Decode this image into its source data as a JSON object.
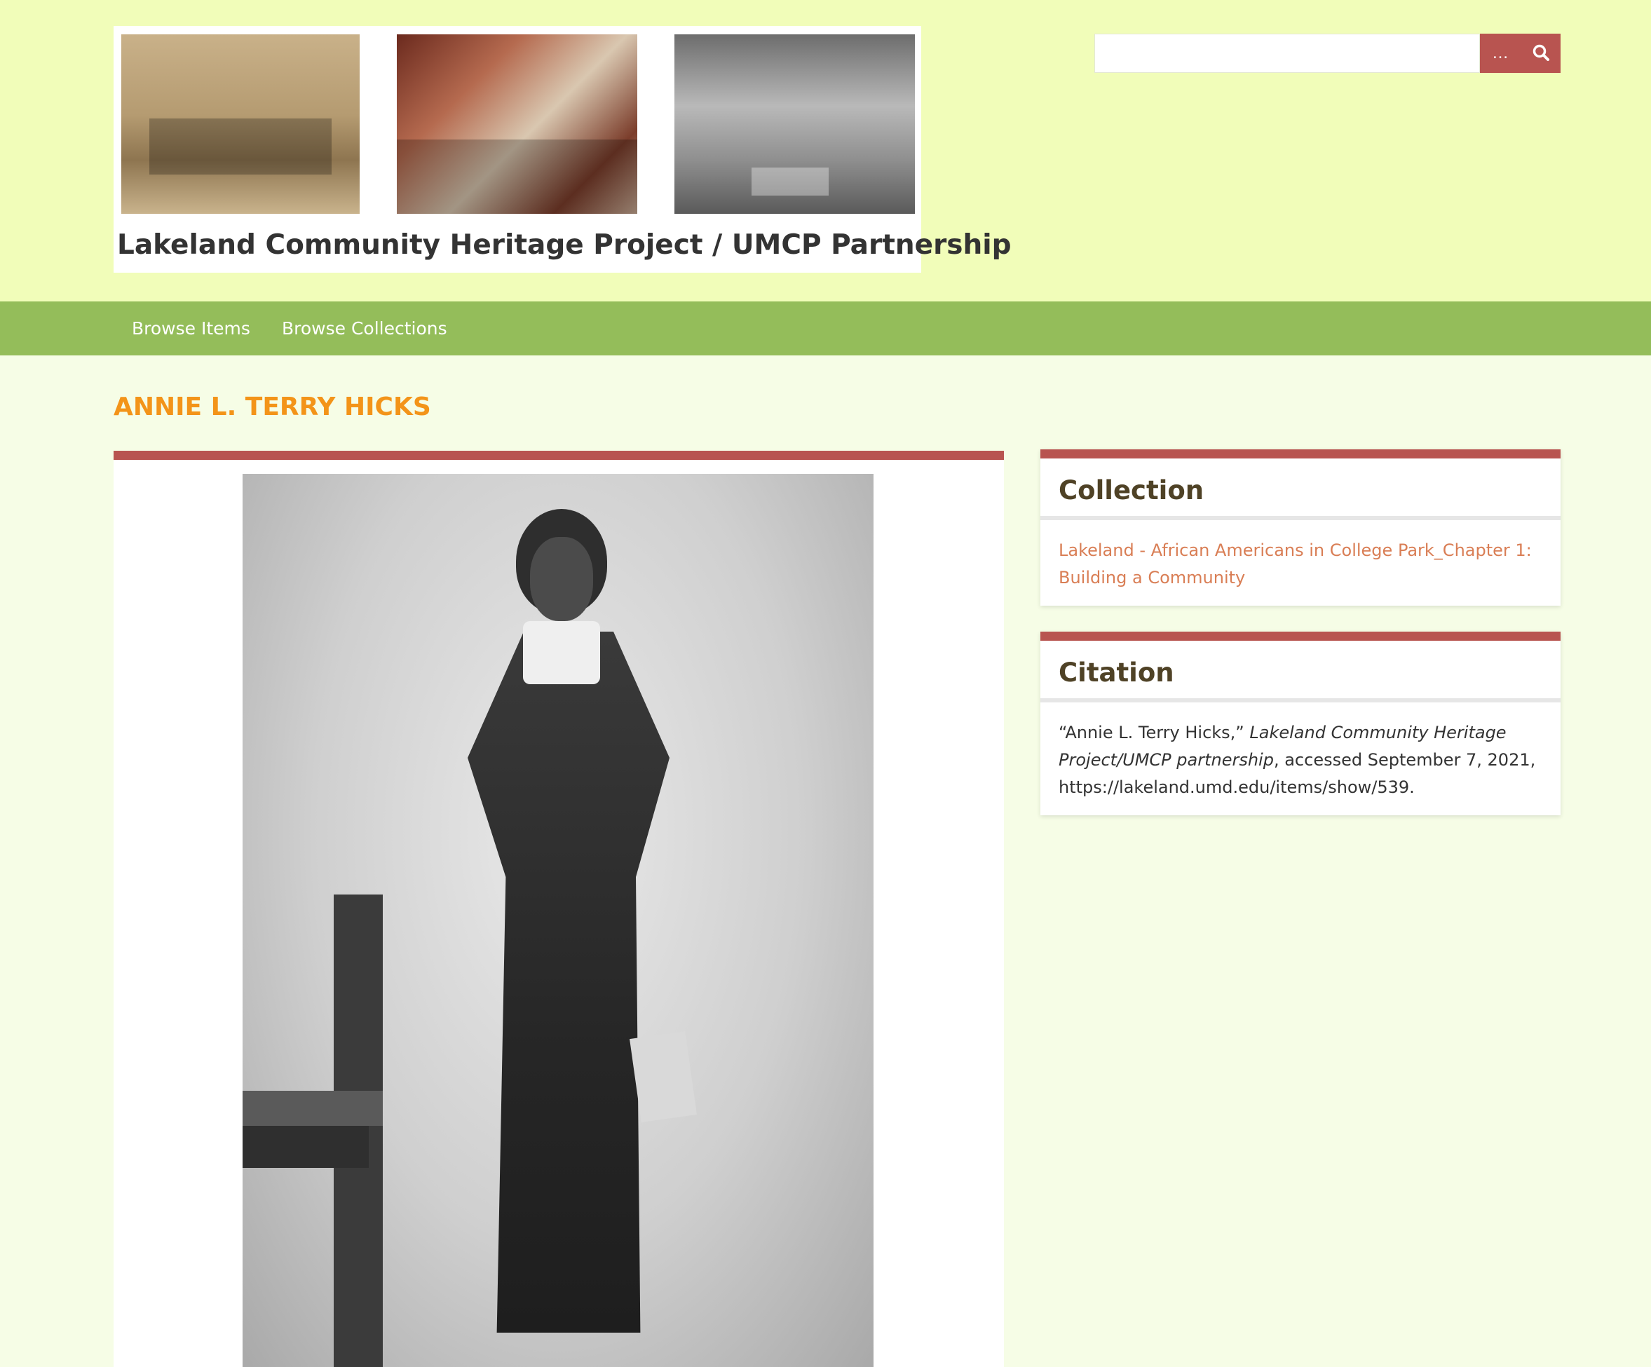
{
  "header": {
    "banner_title": "Lakeland Community Heritage Project / UMCP Partnership",
    "search": {
      "placeholder": "",
      "options_label": "…",
      "go_icon": "search-icon"
    }
  },
  "nav": {
    "items": [
      "Browse Items",
      "Browse Collections"
    ]
  },
  "item": {
    "title": "ANNIE L. TERRY HICKS"
  },
  "sidebar": {
    "collection": {
      "heading": "Collection",
      "link_text": "Lakeland - African Americans in College Park_Chapter 1: Building a Community"
    },
    "citation": {
      "heading": "Citation",
      "quote": "“Annie L. Terry Hicks,” ",
      "source": "Lakeland Community Heritage Project/UMCP partnership",
      "rest": ", accessed September 7, 2021, https://lakeland.umd.edu/items/show/539."
    }
  },
  "colors": {
    "header_bg": "#f1fdb9",
    "nav_bg": "#94bd5a",
    "accent": "#b85450",
    "title": "#f39419",
    "link": "#d97e55"
  }
}
